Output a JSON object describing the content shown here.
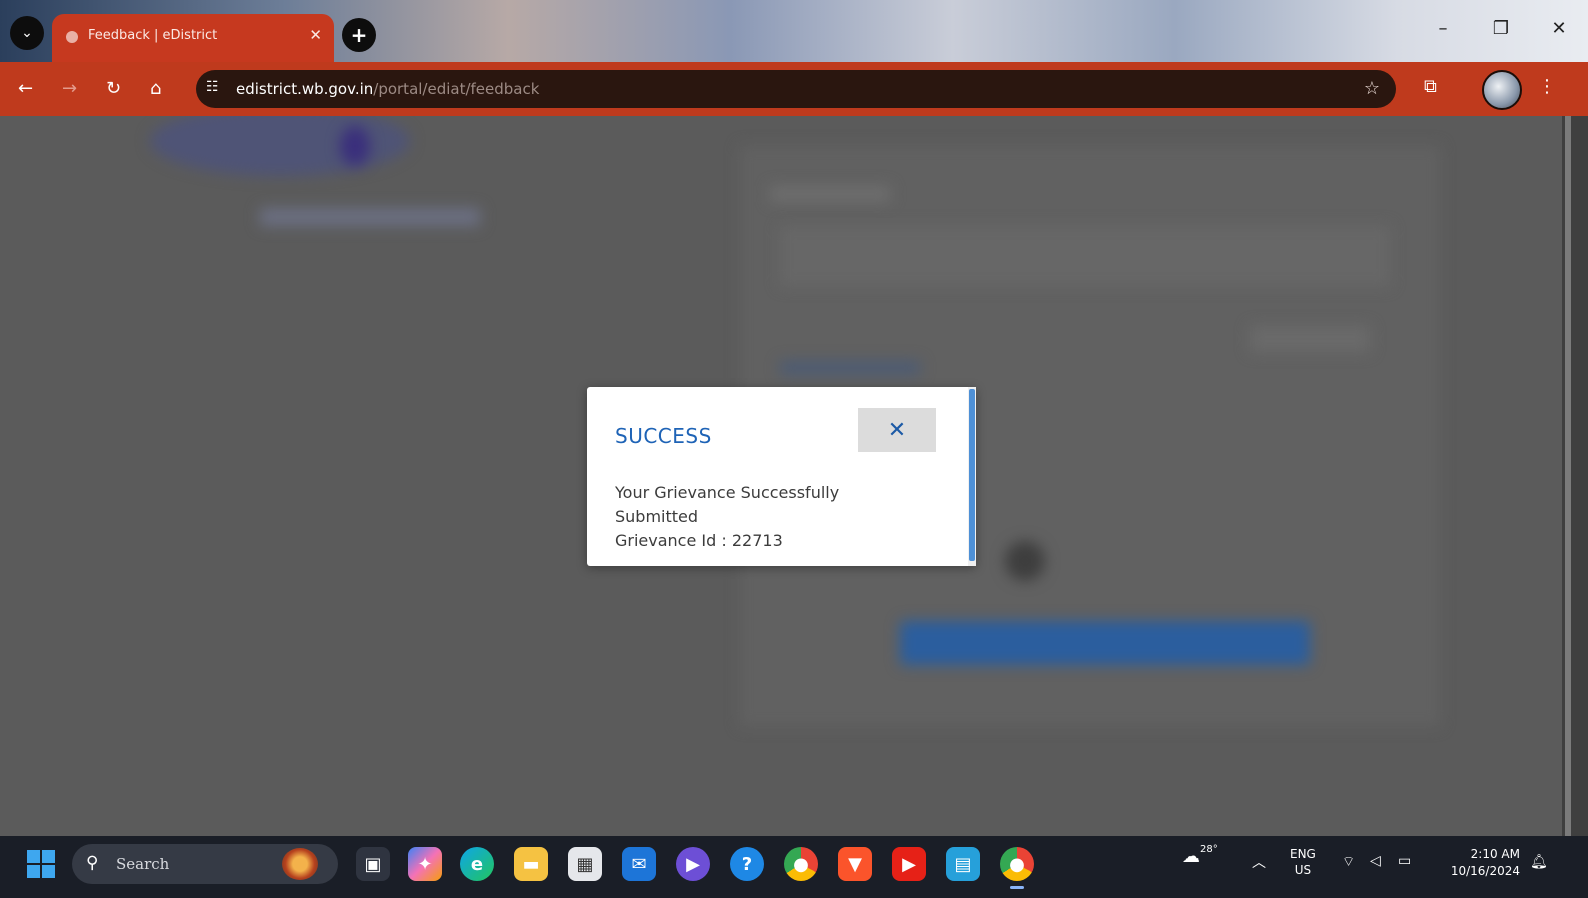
{
  "browser": {
    "tab": {
      "title": "Feedback | eDistrict"
    },
    "url": {
      "host": "edistrict.wb.gov.in",
      "path": "/portal/ediat/feedback"
    }
  },
  "modal": {
    "title": "SUCCESS",
    "close_icon": "close-icon",
    "message_line1": "Your Grievance Successfully",
    "message_line2": "Submitted",
    "grievance_label": "Grievance Id : 22713"
  },
  "taskbar": {
    "search_label": "Search",
    "language": "ENG",
    "region": "US",
    "time": "2:10 AM",
    "date": "10/16/2024",
    "weather": "28°"
  },
  "colors": {
    "browser_accent": "#bf3a1d",
    "modal_title": "#1e63b6",
    "overlay": "#5b5b5b"
  }
}
